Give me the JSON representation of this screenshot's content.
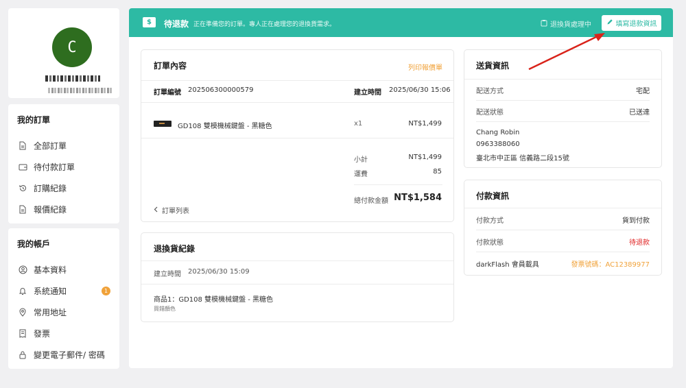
{
  "profile": {
    "avatar_letter": "C"
  },
  "orders_menu": {
    "title": "我的訂單",
    "items": [
      {
        "label": "全部訂單",
        "icon": "document-icon"
      },
      {
        "label": "待付款訂單",
        "icon": "wallet-icon"
      },
      {
        "label": "訂購紀錄",
        "icon": "history-icon"
      },
      {
        "label": "報價紀錄",
        "icon": "document-icon"
      }
    ]
  },
  "account_menu": {
    "title": "我的帳戶",
    "items": [
      {
        "label": "基本資料",
        "icon": "user-circle-icon"
      },
      {
        "label": "系統通知",
        "icon": "bell-icon",
        "badge": "1"
      },
      {
        "label": "常用地址",
        "icon": "location-pin-icon"
      },
      {
        "label": "發票",
        "icon": "receipt-icon"
      },
      {
        "label": "變更電子郵件/ 密碼",
        "icon": "lock-icon"
      }
    ]
  },
  "banner": {
    "icon_glyph": "$",
    "status": "待退款",
    "description": "正在準備您的訂單。專人正在處理您的退換貨需求。",
    "process_status": "退換貨處理中",
    "fill_button": "填寫退款資訊",
    "color": "#2dbaa4"
  },
  "order": {
    "title": "訂單內容",
    "print_link": "列印報價單",
    "number_label": "訂單編號",
    "number": "202506300000579",
    "created_label": "建立時間",
    "created": "2025/06/30 15:06",
    "item_name": "GD108 雙模機械鍵盤 - 黑糖色",
    "item_qty": "x1",
    "item_price": "NT$1,499",
    "subtotal_label": "小計",
    "subtotal": "NT$1,499",
    "shipping_label": "運費",
    "shipping": "85",
    "total_label": "總付款金額",
    "total": "NT$1,584",
    "back_link": "訂單列表"
  },
  "returns": {
    "title": "退換貨紀錄",
    "created_label": "建立時間",
    "created": "2025/06/30 15:09",
    "item": "商品1：GD108 雙模機械鍵盤 - 黑糖色",
    "reason": "買錯顏色"
  },
  "shipping": {
    "title": "送貨資訊",
    "method_label": "配送方式",
    "method": "宅配",
    "status_label": "配送狀態",
    "status": "已送達",
    "name": "Chang Robin",
    "phone": "0963388060",
    "address": "臺北市中正區 信義路二段15號"
  },
  "payment": {
    "title": "付款資訊",
    "method_label": "付款方式",
    "method": "貨到付款",
    "status_label": "付款狀態",
    "status": "待退款",
    "carrier_label": "darkFlash 會員載具",
    "invoice": "發票號碼：AC12389977"
  }
}
